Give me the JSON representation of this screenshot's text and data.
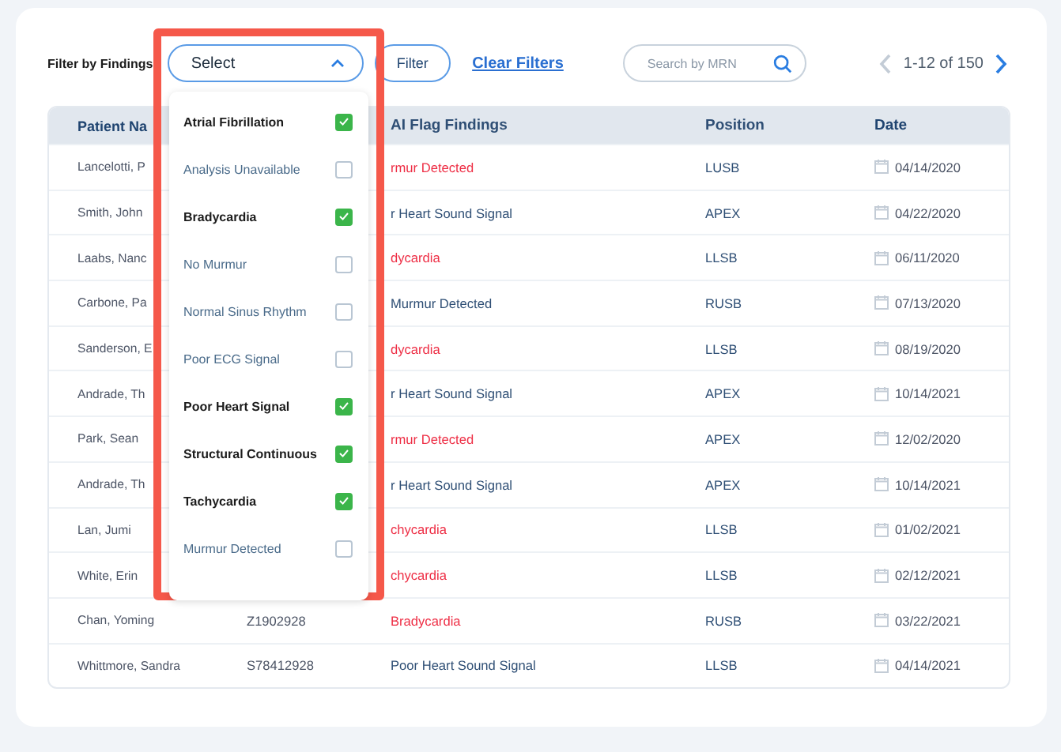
{
  "filter": {
    "label": "Filter by Findings",
    "select": {
      "value": "Select",
      "expanded": true
    },
    "filter_button": "Filter",
    "clear_link": "Clear Filters"
  },
  "search": {
    "placeholder": "Search by MRN"
  },
  "pagination": {
    "range": "1-12 of 150",
    "prev_disabled": true
  },
  "dropdown_options": [
    {
      "label": "Atrial Fibrillation",
      "checked": true
    },
    {
      "label": "Analysis Unavailable",
      "checked": false
    },
    {
      "label": "Bradycardia",
      "checked": true
    },
    {
      "label": "No Murmur",
      "checked": false
    },
    {
      "label": "Normal Sinus Rhythm",
      "checked": false
    },
    {
      "label": "Poor ECG Signal",
      "checked": false
    },
    {
      "label": "Poor Heart Signal",
      "checked": true
    },
    {
      "label": "Structural Continuous",
      "checked": true
    },
    {
      "label": "Tachycardia",
      "checked": true
    },
    {
      "label": "Murmur Detected",
      "checked": false
    }
  ],
  "table": {
    "columns": [
      "Patient Na",
      "AI Flag Findings",
      "Position",
      "Date"
    ],
    "rows": [
      {
        "name": "Lancelotti, P",
        "finding": "rmur Detected",
        "alert": true,
        "position": "LUSB",
        "date": "04/14/2020"
      },
      {
        "name": "Smith, John",
        "finding": "r Heart Sound Signal",
        "alert": false,
        "position": "APEX",
        "date": "04/22/2020"
      },
      {
        "name": "Laabs, Nanc",
        "finding": "dycardia",
        "alert": true,
        "position": "LLSB",
        "date": "06/11/2020"
      },
      {
        "name": "Carbone, Pa",
        "finding": "Murmur Detected",
        "alert": false,
        "position": "RUSB",
        "date": "07/13/2020"
      },
      {
        "name": "Sanderson, E",
        "finding": "dycardia",
        "alert": true,
        "position": "LLSB",
        "date": "08/19/2020"
      },
      {
        "name": "Andrade, Th",
        "finding": "r Heart Sound Signal",
        "alert": false,
        "position": "APEX",
        "date": "10/14/2021"
      },
      {
        "name": "Park, Sean",
        "finding": "rmur Detected",
        "alert": true,
        "position": "APEX",
        "date": "12/02/2020"
      },
      {
        "name": "Andrade, Th",
        "finding": "r Heart Sound Signal",
        "alert": false,
        "position": "APEX",
        "date": "10/14/2021"
      },
      {
        "name": "Lan, Jumi",
        "finding": "chycardia",
        "alert": true,
        "position": "LLSB",
        "date": "01/02/2021"
      },
      {
        "name": "White, Erin",
        "finding": "chycardia",
        "alert": true,
        "position": "LLSB",
        "date": "02/12/2021"
      },
      {
        "name": "Chan, Yoming",
        "mrn": "Z1902928",
        "finding": "Bradycardia",
        "alert": true,
        "position": "RUSB",
        "date": "03/22/2021"
      },
      {
        "name": "Whittmore, Sandra",
        "mrn": "S78412928",
        "finding": "Poor Heart Sound Signal",
        "alert": false,
        "position": "LLSB",
        "date": "04/14/2021"
      }
    ]
  }
}
